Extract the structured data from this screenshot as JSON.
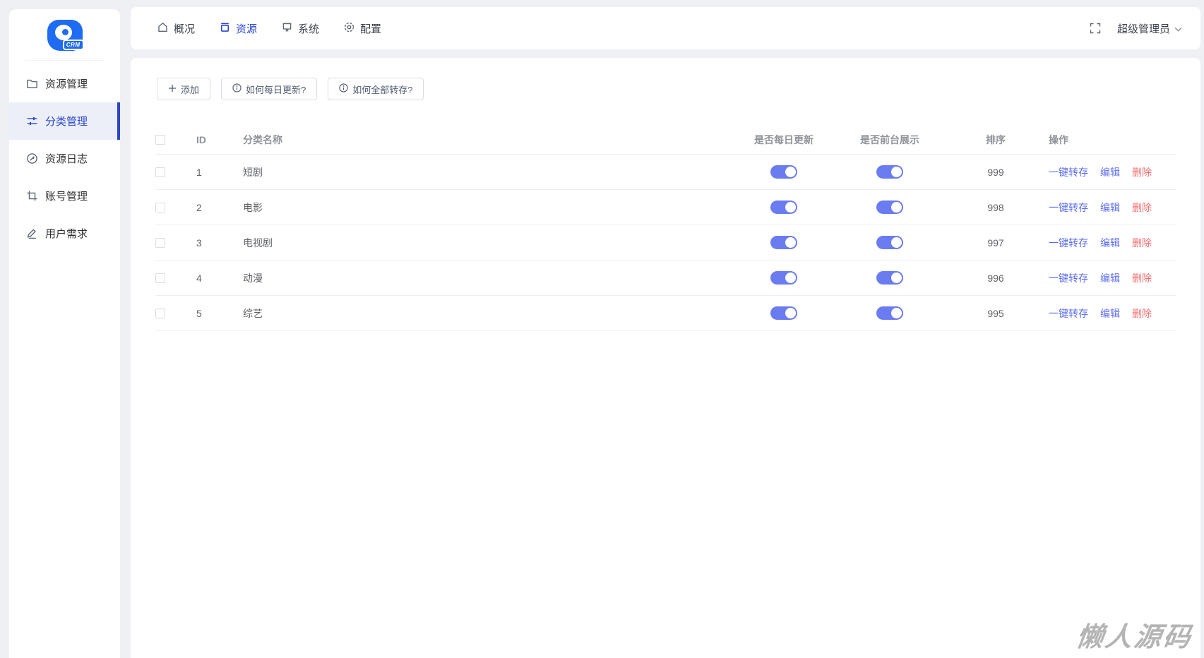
{
  "app": {
    "logo_text": "CRM"
  },
  "sidebar": {
    "items": [
      {
        "label": "资源管理",
        "icon": "folder-icon",
        "active": false
      },
      {
        "label": "分类管理",
        "icon": "sliders-icon",
        "active": true
      },
      {
        "label": "资源日志",
        "icon": "compass-icon",
        "active": false
      },
      {
        "label": "账号管理",
        "icon": "crop-icon",
        "active": false
      },
      {
        "label": "用户需求",
        "icon": "pencil-icon",
        "active": false
      }
    ]
  },
  "topnav": {
    "tabs": [
      {
        "label": "概况",
        "icon": "home-icon",
        "active": false
      },
      {
        "label": "资源",
        "icon": "box-icon",
        "active": true
      },
      {
        "label": "系统",
        "icon": "board-icon",
        "active": false
      },
      {
        "label": "配置",
        "icon": "gear-icon",
        "active": false
      }
    ],
    "fullscreen_icon": "fullscreen-icon",
    "user": {
      "name": "超级管理员",
      "chevron_icon": "chevron-down-icon"
    }
  },
  "toolbar": {
    "buttons": [
      {
        "label": "添加",
        "icon": "plus-icon"
      },
      {
        "label": "如何每日更新?",
        "icon": "info-icon"
      },
      {
        "label": "如何全部转存?",
        "icon": "info-icon"
      }
    ]
  },
  "table": {
    "columns": {
      "id": "ID",
      "name": "分类名称",
      "daily_update": "是否每日更新",
      "front_display": "是否前台展示",
      "sort": "排序",
      "actions": "操作"
    },
    "rows": [
      {
        "id": 1,
        "name": "短剧",
        "daily_update": true,
        "front_display": true,
        "sort": 999
      },
      {
        "id": 2,
        "name": "电影",
        "daily_update": true,
        "front_display": true,
        "sort": 998
      },
      {
        "id": 3,
        "name": "电视剧",
        "daily_update": true,
        "front_display": true,
        "sort": 997
      },
      {
        "id": 4,
        "name": "动漫",
        "daily_update": true,
        "front_display": true,
        "sort": 996
      },
      {
        "id": 5,
        "name": "综艺",
        "daily_update": true,
        "front_display": true,
        "sort": 995
      }
    ],
    "actions": {
      "transfer": "一键转存",
      "edit": "编辑",
      "delete": "删除"
    }
  },
  "watermark": "懒人源码",
  "colors": {
    "accent_dark_blue": "#2b46c9",
    "toggle_blue": "#6b7cf0",
    "link_blue": "#5a6cf0",
    "danger_red": "#f56c6c",
    "logo_blue": "#1f6bf2",
    "page_bg": "#eef0f4"
  }
}
